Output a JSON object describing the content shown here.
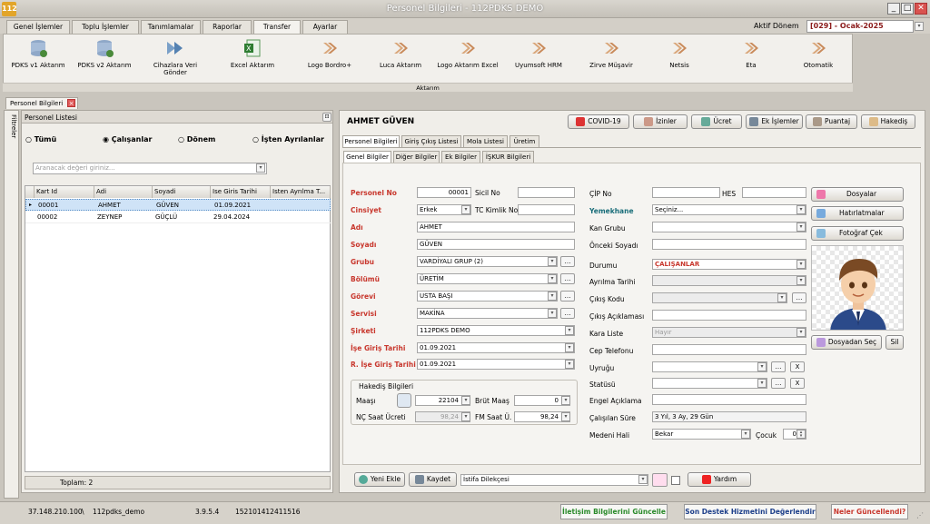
{
  "window": {
    "title": "Personel Bilgileri - 112PDKS DEMO",
    "logo": "112"
  },
  "menu_tabs": [
    "Genel İşlemler",
    "Toplu İşlemler",
    "Tanımlamalar",
    "Raporlar",
    "Transfer",
    "Ayarlar"
  ],
  "active_tab": "Transfer",
  "donem": {
    "label": "Aktif Dönem",
    "value": "[029] - Ocak-2025"
  },
  "ribbon": {
    "group_label": "Aktarım",
    "items": [
      "PDKS v1 Aktarım",
      "PDKS v2 Aktarım",
      "Cihazlara Veri Gönder",
      "Excel Aktarım",
      "Logo Bordro+",
      "Luca Aktarım",
      "Logo Aktarım Excel",
      "Uyumsoft HRM",
      "Zirve Müşavir",
      "Netsis",
      "Eta",
      "Otomatik"
    ]
  },
  "doc_tab": "Personel Bilgileri",
  "left": {
    "side_tab": "Filtreler",
    "title": "Personel Listesi",
    "radios": [
      "Tümü",
      "Çalışanlar",
      "Dönem",
      "İşten Ayrılanlar"
    ],
    "selected_radio": "Çalışanlar",
    "search_placeholder": "Aranacak değeri giriniz...",
    "columns": [
      "Kart Id",
      "Adi",
      "Soyadi",
      "Ise Giris Tarihi",
      "Isten Ayrılma T..."
    ],
    "rows": [
      [
        "00001",
        "AHMET",
        "GÜVEN",
        "01.09.2021",
        ""
      ],
      [
        "00002",
        "ZEYNEP",
        "GÜÇLÜ",
        "29.04.2024",
        ""
      ]
    ],
    "total": "Toplam: 2"
  },
  "right": {
    "person_name": "AHMET GÜVEN",
    "top_buttons": [
      "COVID-19",
      "İzinler",
      "Ücret",
      "Ek İşlemler",
      "Puantaj",
      "Hakediş"
    ],
    "tabs": [
      "Personel Bilgileri",
      "Giriş Çıkış Listesi",
      "Mola Listesi",
      "Üretim"
    ],
    "subtabs": [
      "Genel Bilgiler",
      "Diğer Bilgiler",
      "Ek Bilgiler",
      "İŞKUR Bilgileri"
    ],
    "left_fields": {
      "personel_no_label": "Personel No",
      "personel_no": "00001",
      "sicil_no_label": "Sicil No",
      "sicil_no": "",
      "cinsiyet_label": "Cinsiyet",
      "cinsiyet": "Erkek",
      "tc_label": "TC Kimlik No",
      "tc": "",
      "adi_label": "Adı",
      "adi": "AHMET",
      "soyadi_label": "Soyadı",
      "soyadi": "GÜVEN",
      "grubu_label": "Grubu",
      "grubu": "VARDİYALI GRUP (2)",
      "bolumu_label": "Bölümü",
      "bolumu": "ÜRETİM",
      "gorevi_label": "Görevi",
      "gorevi": "USTA BAŞI",
      "servisi_label": "Servisi",
      "servisi": "MAKİNA",
      "sirketi_label": "Şirketi",
      "sirketi": "112PDKS DEMO",
      "ise_giris_label": "İşe Giriş Tarihi",
      "ise_giris": "01.09.2021",
      "r_ise_giris_label": "R. İşe Giriş Tarihi",
      "r_ise_giris": "01.09.2021"
    },
    "hakedis": {
      "title": "Hakediş Bilgileri",
      "maasi_label": "Maaşı",
      "maasi": "22104",
      "brut_label": "Brüt Maaş",
      "brut": "0",
      "nc_label": "NÇ Saat Ücreti",
      "nc": "98,24",
      "fm_label": "FM Saat Ü.",
      "fm": "98,24"
    },
    "mid_fields": {
      "cip_label": "ÇİP No",
      "cip": "",
      "hes_label": "HES",
      "hes": "",
      "yemekhane_label": "Yemekhane",
      "yemekhane": "Seçiniz...",
      "kan_label": "Kan Grubu",
      "kan": "",
      "onceki_label": "Önceki Soyadı",
      "onceki": "",
      "durumu_label": "Durumu",
      "durumu": "ÇALIŞANLAR",
      "ayrilma_label": "Ayrılma Tarihi",
      "ayrilma": "",
      "cikis_kodu_label": "Çıkış Kodu",
      "cikis_kodu": "",
      "cikis_acik_label": "Çıkış Açıklaması",
      "cikis_acik": "",
      "kara_label": "Kara Liste",
      "kara": "Hayır",
      "cep_label": "Cep Telefonu",
      "cep": "",
      "uyruk_label": "Uyruğu",
      "uyruk": "",
      "statu_label": "Statüsü",
      "statu": "",
      "engel_label": "Engel Açıklama",
      "engel": "",
      "calisilan_label": "Çalışılan Süre",
      "calisilan": "3 Yıl, 3 Ay, 29 Gün",
      "medeni_label": "Medeni Hali",
      "medeni": "Bekar",
      "cocuk_label": "Çocuk",
      "cocuk": "0"
    },
    "side_buttons": [
      "Dosyalar",
      "Hatırlatmalar",
      "Fotoğraf Çek"
    ],
    "photo_buttons": [
      "Dosyadan Seç",
      "Sil"
    ],
    "bottom": {
      "new": "Yeni Ekle",
      "save": "Kaydet",
      "istifa": "İstifa Dilekçesi",
      "help": "Yardım"
    }
  },
  "status": {
    "ip": "37.148.210.100",
    "sep": "\\",
    "db": "112pdks_demo",
    "version": "3.9.5.4",
    "code": "152101412411516",
    "btn1": "İletişim Bilgilerini Güncelle",
    "btn2": "Son Destek Hizmetini Değerlendir",
    "btn3": "Neler Güncellendi?"
  },
  "colors": {
    "accent_red": "#c8372d",
    "teal": "#1a6e7a",
    "selected_row": "#cfe3f7"
  }
}
